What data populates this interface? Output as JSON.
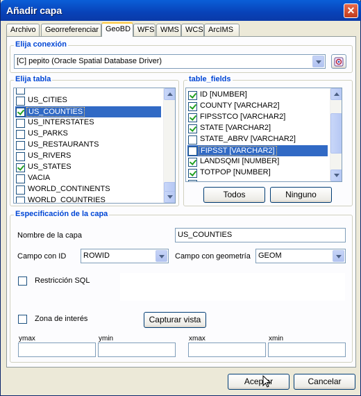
{
  "window": {
    "title": "Añadir capa",
    "close_glyph": "✕"
  },
  "tabs": [
    "Archivo",
    "Georreferenciar",
    "GeoBD",
    "WFS",
    "WMS",
    "WCS",
    "ArcIMS"
  ],
  "connection": {
    "group_label": "Elija conexión",
    "selected": "[C] pepito (Oracle Spatial Database Driver)",
    "button_icon": "database-connect-icon"
  },
  "tables": {
    "group_label": "Elija tabla",
    "items": [
      {
        "label": "US_CITIES",
        "checked": false,
        "selected": false
      },
      {
        "label": "US_COUNTIES",
        "checked": true,
        "selected": true
      },
      {
        "label": "US_INTERSTATES",
        "checked": false,
        "selected": false
      },
      {
        "label": "US_PARKS",
        "checked": false,
        "selected": false
      },
      {
        "label": "US_RESTAURANTS",
        "checked": false,
        "selected": false
      },
      {
        "label": "US_RIVERS",
        "checked": false,
        "selected": false
      },
      {
        "label": "US_STATES",
        "checked": true,
        "selected": false
      },
      {
        "label": "VACIA",
        "checked": false,
        "selected": false
      },
      {
        "label": "WORLD_CONTINENTS",
        "checked": false,
        "selected": false
      },
      {
        "label": "WORLD_COUNTRIES",
        "checked": false,
        "selected": false
      }
    ],
    "scroll_position": 0.93
  },
  "fields": {
    "group_label": "table_fields",
    "items": [
      {
        "label": "ID [NUMBER]",
        "checked": true,
        "selected": false
      },
      {
        "label": "COUNTY [VARCHAR2]",
        "checked": true,
        "selected": false
      },
      {
        "label": "FIPSSTCO [VARCHAR2]",
        "checked": true,
        "selected": false
      },
      {
        "label": "STATE [VARCHAR2]",
        "checked": true,
        "selected": false
      },
      {
        "label": "STATE_ABRV [VARCHAR2]",
        "checked": false,
        "selected": false
      },
      {
        "label": "FIPSST [VARCHAR2]",
        "checked": false,
        "selected": true
      },
      {
        "label": "LANDSQMI [NUMBER]",
        "checked": true,
        "selected": false
      },
      {
        "label": "TOTPOP [NUMBER]",
        "checked": true,
        "selected": false
      }
    ],
    "scroll_position": 0.45,
    "all_label": "Todos",
    "none_label": "Ninguno"
  },
  "spec": {
    "group_label": "Especificación de la capa",
    "layer_name_label": "Nombre de la capa",
    "layer_name_value": "US_COUNTIES",
    "id_field_label": "Campo con ID",
    "id_field_value": "ROWID",
    "geom_field_label": "Campo con geometría",
    "geom_field_value": "GEOM",
    "sql_label": "Restricción SQL",
    "sql_checked": false,
    "zone_label": "Zona de interés",
    "zone_checked": false,
    "capture_label": "Capturar vista",
    "ymax_label": "ymax",
    "ymin_label": "ymin",
    "xmax_label": "xmax",
    "xmin_label": "xmin"
  },
  "footer": {
    "accept_label": "Aceptar",
    "cancel_label": "Cancelar"
  }
}
